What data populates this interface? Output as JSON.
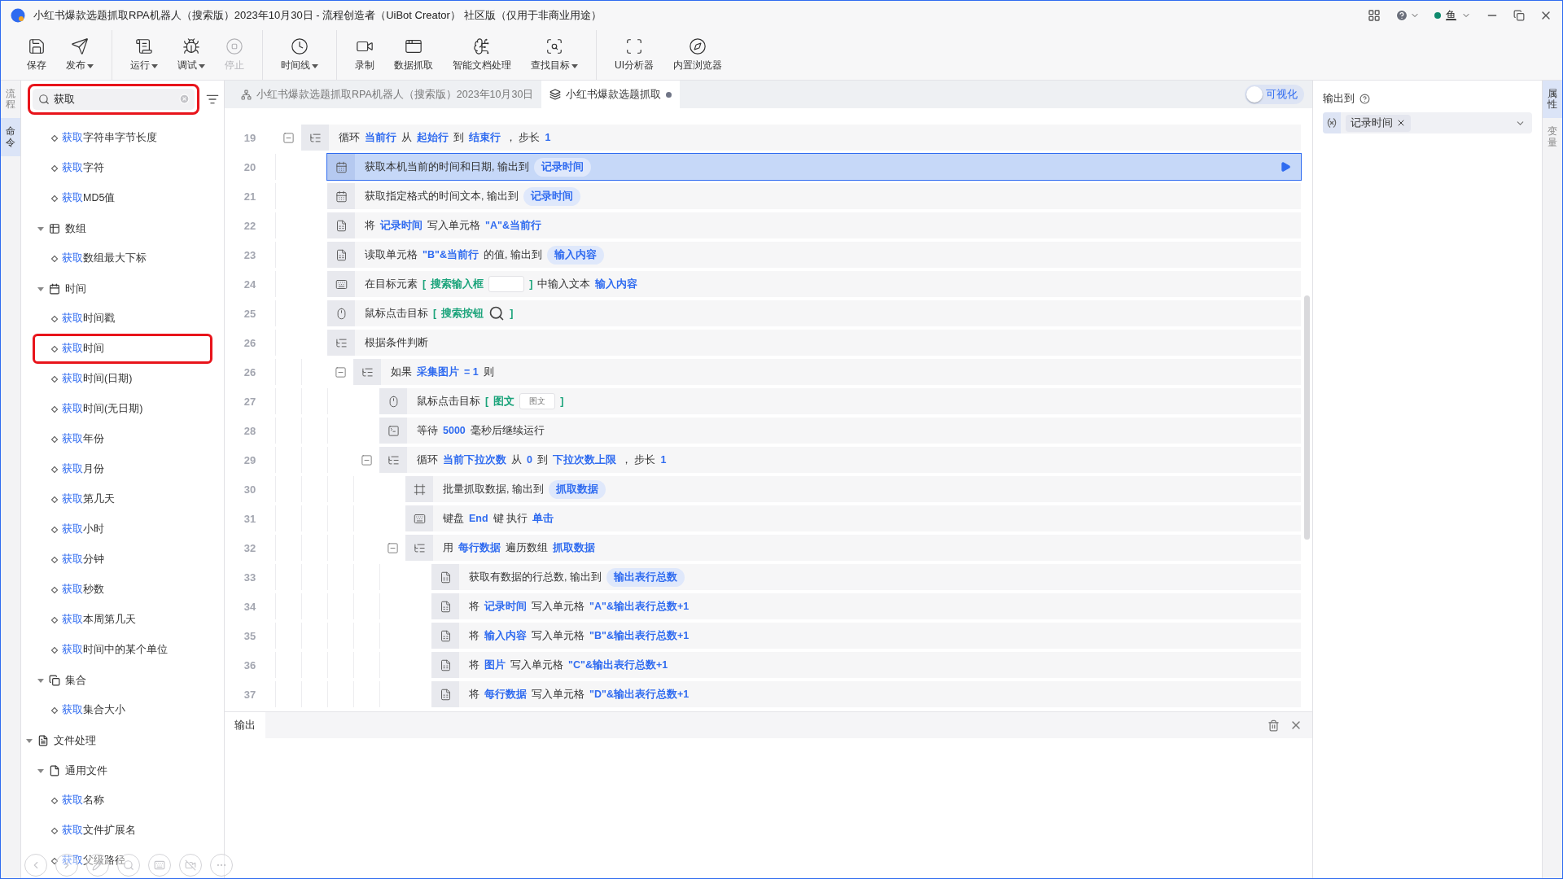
{
  "window": {
    "title": "小红书爆款选题抓取RPA机器人（搜索版）2023年10月30日 - 流程创造者（UiBot Creator） 社区版（仅用于非商业用途）",
    "user": "鱼"
  },
  "toolbar": {
    "groups": [
      {
        "buttons": [
          {
            "label": "保存",
            "dropdown": false,
            "disabled": false
          },
          {
            "label": "发布",
            "dropdown": true,
            "disabled": false
          }
        ]
      },
      {
        "buttons": [
          {
            "label": "运行",
            "dropdown": true,
            "disabled": false
          },
          {
            "label": "调试",
            "dropdown": true,
            "disabled": false
          },
          {
            "label": "停止",
            "dropdown": false,
            "disabled": true
          }
        ]
      },
      {
        "buttons": [
          {
            "label": "时间线",
            "dropdown": true,
            "disabled": false
          }
        ]
      },
      {
        "buttons": [
          {
            "label": "录制",
            "dropdown": false,
            "disabled": false
          },
          {
            "label": "数据抓取",
            "dropdown": false,
            "disabled": false
          },
          {
            "label": "智能文档处理",
            "dropdown": false,
            "disabled": false
          },
          {
            "label": "查找目标",
            "dropdown": true,
            "disabled": false
          }
        ]
      },
      {
        "buttons": [
          {
            "label": "UI分析器",
            "dropdown": false,
            "disabled": false
          },
          {
            "label": "内置浏览器",
            "dropdown": false,
            "disabled": false
          }
        ]
      }
    ]
  },
  "left_tabs": [
    {
      "label": "流程",
      "selected": false
    },
    {
      "label": "命令",
      "selected": true
    }
  ],
  "sidebar": {
    "search": {
      "value": "获取"
    },
    "tree": [
      {
        "children": [
          {
            "children": [
              {
                "match": "获取",
                "label": "字符串字节长度",
                "selected": false
              },
              {
                "match": "获取",
                "label": "字符",
                "selected": false
              },
              {
                "match": "获取",
                "label": "MD5值",
                "selected": false
              }
            ]
          },
          {
            "label": "数组",
            "kind": "array",
            "expanded": true,
            "children": [
              {
                "match": "获取",
                "label": "数组最大下标",
                "selected": false
              }
            ]
          },
          {
            "label": "时间",
            "kind": "time",
            "expanded": true,
            "children": [
              {
                "match": "获取",
                "label": "时间戳",
                "selected": false
              },
              {
                "match": "获取",
                "label": "时间",
                "selected": true
              },
              {
                "match": "获取",
                "label": "时间(日期)",
                "selected": false
              },
              {
                "match": "获取",
                "label": "时间(无日期)",
                "selected": false
              },
              {
                "match": "获取",
                "label": "年份",
                "selected": false
              },
              {
                "match": "获取",
                "label": "月份",
                "selected": false
              },
              {
                "match": "获取",
                "label": "第几天",
                "selected": false
              },
              {
                "match": "获取",
                "label": "小时",
                "selected": false
              },
              {
                "match": "获取",
                "label": "分钟",
                "selected": false
              },
              {
                "match": "获取",
                "label": "秒数",
                "selected": false
              },
              {
                "match": "获取",
                "label": "本周第几天",
                "selected": false
              },
              {
                "match": "获取",
                "label": "时间中的某个单位",
                "selected": false
              }
            ]
          },
          {
            "label": "集合",
            "kind": "collection",
            "expanded": true,
            "children": [
              {
                "match": "获取",
                "label": "集合大小",
                "selected": false
              }
            ]
          }
        ]
      },
      {
        "label": "文件处理",
        "kind": "folder",
        "expanded": true,
        "children": [
          {
            "label": "通用文件",
            "kind": "file",
            "expanded": true,
            "children": [
              {
                "match": "获取",
                "label": "名称",
                "selected": false
              },
              {
                "match": "获取",
                "label": "文件扩展名",
                "selected": false
              },
              {
                "match": "获取",
                "label": "父级路径",
                "selected": false
              }
            ]
          }
        ]
      }
    ]
  },
  "editor": {
    "tabs": [
      {
        "label": "小红书爆款选题抓取RPA机器人（搜索版）2023年10月30日",
        "kind": "project",
        "selected": false,
        "modified": false
      },
      {
        "label": "小红书爆款选题抓取",
        "kind": "flow",
        "selected": true,
        "modified": true
      }
    ],
    "visualize": {
      "label": "可视化",
      "on": false
    },
    "lines": [
      {
        "num": "19",
        "kind": "loop",
        "expanded": true,
        "selected": false,
        "parts": [
          {
            "kind": "text",
            "text": "循环"
          },
          {
            "kind": "var",
            "text": "当前行"
          },
          {
            "kind": "text",
            "text": "从"
          },
          {
            "kind": "var",
            "text": "起始行"
          },
          {
            "kind": "text",
            "text": "到"
          },
          {
            "kind": "var",
            "text": "结束行"
          },
          {
            "kind": "text",
            "text": "，  步长"
          },
          {
            "kind": "var",
            "text": "1"
          }
        ],
        "children": [
          {
            "num": "20",
            "kind": "time",
            "selected": true,
            "parts": [
              {
                "kind": "text",
                "text": "获取本机当前的时间和日期, 输出到"
              },
              {
                "kind": "pill",
                "text": "记录时间"
              }
            ]
          },
          {
            "num": "21",
            "kind": "time",
            "selected": false,
            "parts": [
              {
                "kind": "text",
                "text": "获取指定格式的时间文本, 输出到"
              },
              {
                "kind": "pill",
                "text": "记录时间"
              }
            ]
          },
          {
            "num": "22",
            "kind": "excel",
            "selected": false,
            "parts": [
              {
                "kind": "text",
                "text": "将"
              },
              {
                "kind": "var",
                "text": "记录时间"
              },
              {
                "kind": "text",
                "text": "写入单元格"
              },
              {
                "kind": "var",
                "text": "\"A\"&当前行"
              }
            ]
          },
          {
            "num": "23",
            "kind": "excel",
            "selected": false,
            "parts": [
              {
                "kind": "text",
                "text": "读取单元格"
              },
              {
                "kind": "var",
                "text": "\"B\"&当前行"
              },
              {
                "kind": "text",
                "text": "的值, 输出到"
              },
              {
                "kind": "pill",
                "text": "输入内容"
              }
            ]
          },
          {
            "num": "24",
            "kind": "input",
            "selected": false,
            "parts": [
              {
                "kind": "text",
                "text": "在目标元素"
              },
              {
                "kind": "bracket",
                "text": "["
              },
              {
                "kind": "target",
                "text": "搜索输入框"
              },
              {
                "kind": "thumb"
              },
              {
                "kind": "bracket",
                "text": "]"
              },
              {
                "kind": "text",
                "text": "中输入文本"
              },
              {
                "kind": "var",
                "text": "输入内容"
              }
            ]
          },
          {
            "num": "25",
            "kind": "mouse",
            "selected": false,
            "parts": [
              {
                "kind": "text",
                "text": "鼠标点击目标"
              },
              {
                "kind": "bracket",
                "text": "["
              },
              {
                "kind": "target",
                "text": "搜索按钮"
              },
              {
                "kind": "thumb_search"
              },
              {
                "kind": "bracket",
                "text": "]"
              }
            ]
          },
          {
            "num": "26",
            "kind": "loop",
            "selected": false,
            "parts": [
              {
                "kind": "text",
                "text": "根据条件判断"
              }
            ],
            "children": [
              {
                "num": "26",
                "kind": "loop",
                "expanded": true,
                "selected": false,
                "parts": [
                  {
                    "kind": "text",
                    "text": "如果"
                  },
                  {
                    "kind": "var",
                    "text": "采集图片"
                  },
                  {
                    "kind": "var",
                    "text": "= 1"
                  },
                  {
                    "kind": "text",
                    "text": "则"
                  }
                ],
                "children": [
                  {
                    "num": "27",
                    "kind": "mouse",
                    "selected": false,
                    "parts": [
                      {
                        "kind": "text",
                        "text": "鼠标点击目标"
                      },
                      {
                        "kind": "bracket",
                        "text": "["
                      },
                      {
                        "kind": "target",
                        "text": "图文"
                      },
                      {
                        "kind": "thumb",
                        "text": "图文"
                      },
                      {
                        "kind": "bracket",
                        "text": "]"
                      }
                    ]
                  },
                  {
                    "num": "28",
                    "kind": "wait",
                    "selected": false,
                    "parts": [
                      {
                        "kind": "text",
                        "text": "等待"
                      },
                      {
                        "kind": "var",
                        "text": "5000"
                      },
                      {
                        "kind": "text",
                        "text": "毫秒后继续运行"
                      }
                    ]
                  },
                  {
                    "num": "29",
                    "kind": "loop",
                    "expanded": true,
                    "selected": false,
                    "parts": [
                      {
                        "kind": "text",
                        "text": "循环"
                      },
                      {
                        "kind": "var",
                        "text": "当前下拉次数"
                      },
                      {
                        "kind": "text",
                        "text": "从"
                      },
                      {
                        "kind": "var",
                        "text": "0"
                      },
                      {
                        "kind": "text",
                        "text": "到"
                      },
                      {
                        "kind": "var",
                        "text": "下拉次数上限"
                      },
                      {
                        "kind": "text",
                        "text": "，  步长"
                      },
                      {
                        "kind": "var",
                        "text": "1"
                      }
                    ],
                    "children": [
                      {
                        "num": "30",
                        "kind": "batch",
                        "selected": false,
                        "parts": [
                          {
                            "kind": "text",
                            "text": "批量抓取数据, 输出到"
                          },
                          {
                            "kind": "pill",
                            "text": "抓取数据"
                          }
                        ]
                      },
                      {
                        "num": "31",
                        "kind": "input",
                        "selected": false,
                        "parts": [
                          {
                            "kind": "text",
                            "text": "键盘"
                          },
                          {
                            "kind": "var",
                            "text": "End"
                          },
                          {
                            "kind": "text",
                            "text": "键 执行"
                          },
                          {
                            "kind": "var",
                            "text": "单击"
                          }
                        ]
                      },
                      {
                        "num": "32",
                        "kind": "loop",
                        "expanded": true,
                        "selected": false,
                        "parts": [
                          {
                            "kind": "text",
                            "text": "用"
                          },
                          {
                            "kind": "var",
                            "text": "每行数据"
                          },
                          {
                            "kind": "text",
                            "text": "遍历数组"
                          },
                          {
                            "kind": "var",
                            "text": "抓取数据"
                          }
                        ],
                        "children": [
                          {
                            "num": "33",
                            "kind": "excel",
                            "selected": false,
                            "parts": [
                              {
                                "kind": "text",
                                "text": "获取有数据的行总数, 输出到"
                              },
                              {
                                "kind": "pill",
                                "text": "输出表行总数"
                              }
                            ]
                          },
                          {
                            "num": "34",
                            "kind": "excel",
                            "selected": false,
                            "parts": [
                              {
                                "kind": "text",
                                "text": "将"
                              },
                              {
                                "kind": "var",
                                "text": "记录时间"
                              },
                              {
                                "kind": "text",
                                "text": "写入单元格"
                              },
                              {
                                "kind": "var",
                                "text": "\"A\"&输出表行总数+1"
                              }
                            ]
                          },
                          {
                            "num": "35",
                            "kind": "excel",
                            "selected": false,
                            "parts": [
                              {
                                "kind": "text",
                                "text": "将"
                              },
                              {
                                "kind": "var",
                                "text": "输入内容"
                              },
                              {
                                "kind": "text",
                                "text": "写入单元格"
                              },
                              {
                                "kind": "var",
                                "text": "\"B\"&输出表行总数+1"
                              }
                            ]
                          },
                          {
                            "num": "36",
                            "kind": "excel",
                            "selected": false,
                            "parts": [
                              {
                                "kind": "text",
                                "text": "将"
                              },
                              {
                                "kind": "var",
                                "text": "图片"
                              },
                              {
                                "kind": "text",
                                "text": "写入单元格"
                              },
                              {
                                "kind": "var",
                                "text": "\"C\"&输出表行总数+1"
                              }
                            ]
                          },
                          {
                            "num": "37",
                            "kind": "excel",
                            "selected": false,
                            "parts": [
                              {
                                "kind": "text",
                                "text": "将"
                              },
                              {
                                "kind": "var",
                                "text": "每行数据"
                              },
                              {
                                "kind": "text",
                                "text": "写入单元格"
                              },
                              {
                                "kind": "var",
                                "text": "\"D\"&输出表行总数+1"
                              }
                            ]
                          }
                        ]
                      }
                    ]
                  }
                ]
              }
            ]
          }
        ]
      }
    ],
    "output": {
      "tab": "输出"
    }
  },
  "properties": {
    "label": "输出到",
    "tags": [
      "记录时间"
    ]
  },
  "right_tabs": [
    {
      "label": "属性",
      "selected": true
    },
    {
      "label": "变量",
      "selected": false
    }
  ]
}
